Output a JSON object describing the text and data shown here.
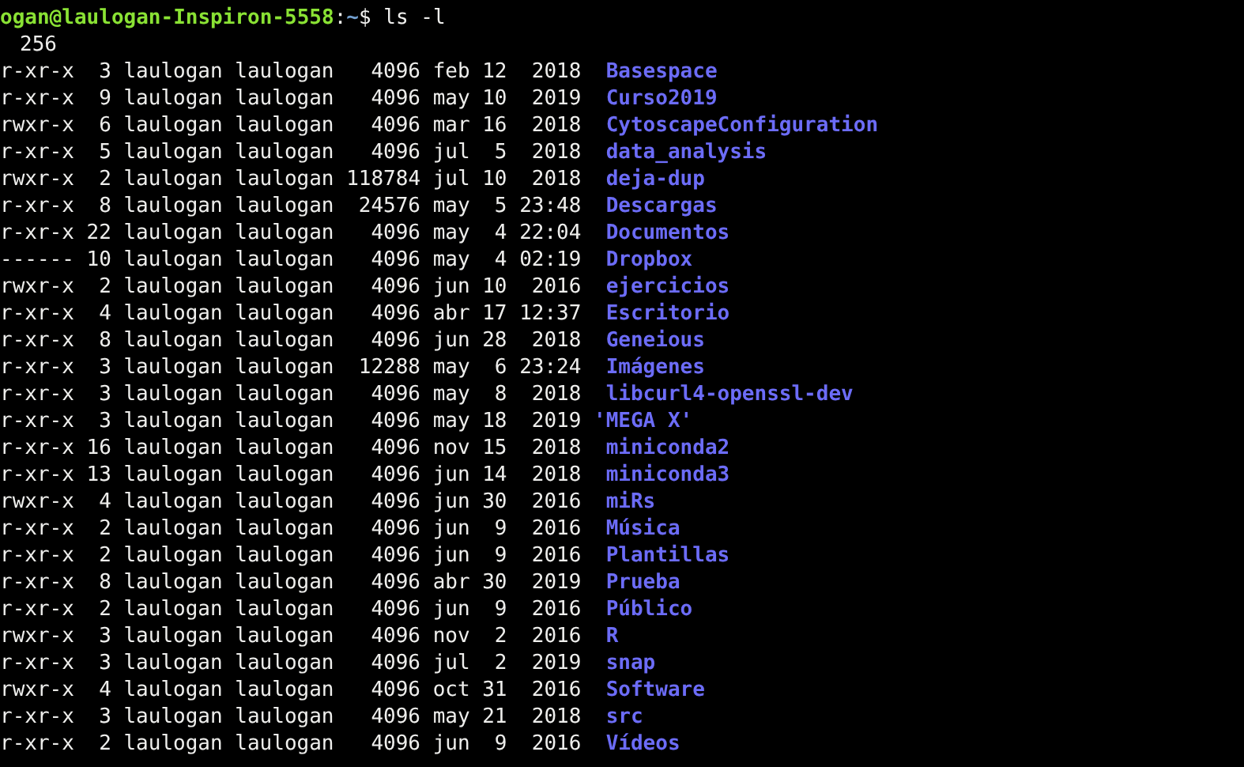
{
  "prompt": {
    "user_host": "ogan@laulogan-Inspiron-5558",
    "separator": ":",
    "path": "~",
    "symbol": "$",
    "command": "ls -l"
  },
  "total": {
    "value": "256"
  },
  "entries": [
    {
      "perms": "r-xr-x",
      "links": "3",
      "owner": "laulogan",
      "group": "laulogan",
      "size": "4096",
      "month": "feb",
      "day": "12",
      "time": "2018",
      "name": "Basespace",
      "kind": "dir",
      "quoted": false
    },
    {
      "perms": "r-xr-x",
      "links": "9",
      "owner": "laulogan",
      "group": "laulogan",
      "size": "4096",
      "month": "may",
      "day": "10",
      "time": "2019",
      "name": "Curso2019",
      "kind": "dir",
      "quoted": false
    },
    {
      "perms": "rwxr-x",
      "links": "6",
      "owner": "laulogan",
      "group": "laulogan",
      "size": "4096",
      "month": "mar",
      "day": "16",
      "time": "2018",
      "name": "CytoscapeConfiguration",
      "kind": "dir",
      "quoted": false
    },
    {
      "perms": "r-xr-x",
      "links": "5",
      "owner": "laulogan",
      "group": "laulogan",
      "size": "4096",
      "month": "jul",
      "day": "5",
      "time": "2018",
      "name": "data_analysis",
      "kind": "dir",
      "quoted": false
    },
    {
      "perms": "rwxr-x",
      "links": "2",
      "owner": "laulogan",
      "group": "laulogan",
      "size": "118784",
      "month": "jul",
      "day": "10",
      "time": "2018",
      "name": "deja-dup",
      "kind": "dir",
      "quoted": false
    },
    {
      "perms": "r-xr-x",
      "links": "8",
      "owner": "laulogan",
      "group": "laulogan",
      "size": "24576",
      "month": "may",
      "day": "5",
      "time": "23:48",
      "name": "Descargas",
      "kind": "dir",
      "quoted": false
    },
    {
      "perms": "r-xr-x",
      "links": "22",
      "owner": "laulogan",
      "group": "laulogan",
      "size": "4096",
      "month": "may",
      "day": "4",
      "time": "22:04",
      "name": "Documentos",
      "kind": "dir",
      "quoted": false
    },
    {
      "perms": "------",
      "links": "10",
      "owner": "laulogan",
      "group": "laulogan",
      "size": "4096",
      "month": "may",
      "day": "4",
      "time": "02:19",
      "name": "Dropbox",
      "kind": "dir",
      "quoted": false
    },
    {
      "perms": "rwxr-x",
      "links": "2",
      "owner": "laulogan",
      "group": "laulogan",
      "size": "4096",
      "month": "jun",
      "day": "10",
      "time": "2016",
      "name": "ejercicios",
      "kind": "dir",
      "quoted": false
    },
    {
      "perms": "r-xr-x",
      "links": "4",
      "owner": "laulogan",
      "group": "laulogan",
      "size": "4096",
      "month": "abr",
      "day": "17",
      "time": "12:37",
      "name": "Escritorio",
      "kind": "dir",
      "quoted": false
    },
    {
      "perms": "r-xr-x",
      "links": "8",
      "owner": "laulogan",
      "group": "laulogan",
      "size": "4096",
      "month": "jun",
      "day": "28",
      "time": "2018",
      "name": "Geneious",
      "kind": "dir",
      "quoted": false
    },
    {
      "perms": "r-xr-x",
      "links": "3",
      "owner": "laulogan",
      "group": "laulogan",
      "size": "12288",
      "month": "may",
      "day": "6",
      "time": "23:24",
      "name": "Imágenes",
      "kind": "dir",
      "quoted": false
    },
    {
      "perms": "r-xr-x",
      "links": "3",
      "owner": "laulogan",
      "group": "laulogan",
      "size": "4096",
      "month": "may",
      "day": "8",
      "time": "2018",
      "name": "libcurl4-openssl-dev",
      "kind": "dir",
      "quoted": false
    },
    {
      "perms": "r-xr-x",
      "links": "3",
      "owner": "laulogan",
      "group": "laulogan",
      "size": "4096",
      "month": "may",
      "day": "18",
      "time": "2019",
      "name": "'MEGA X'",
      "kind": "dir",
      "quoted": true
    },
    {
      "perms": "r-xr-x",
      "links": "16",
      "owner": "laulogan",
      "group": "laulogan",
      "size": "4096",
      "month": "nov",
      "day": "15",
      "time": "2018",
      "name": "miniconda2",
      "kind": "dir",
      "quoted": false
    },
    {
      "perms": "r-xr-x",
      "links": "13",
      "owner": "laulogan",
      "group": "laulogan",
      "size": "4096",
      "month": "jun",
      "day": "14",
      "time": "2018",
      "name": "miniconda3",
      "kind": "dir",
      "quoted": false
    },
    {
      "perms": "rwxr-x",
      "links": "4",
      "owner": "laulogan",
      "group": "laulogan",
      "size": "4096",
      "month": "jun",
      "day": "30",
      "time": "2016",
      "name": "miRs",
      "kind": "dir",
      "quoted": false
    },
    {
      "perms": "r-xr-x",
      "links": "2",
      "owner": "laulogan",
      "group": "laulogan",
      "size": "4096",
      "month": "jun",
      "day": "9",
      "time": "2016",
      "name": "Música",
      "kind": "dir",
      "quoted": false
    },
    {
      "perms": "r-xr-x",
      "links": "2",
      "owner": "laulogan",
      "group": "laulogan",
      "size": "4096",
      "month": "jun",
      "day": "9",
      "time": "2016",
      "name": "Plantillas",
      "kind": "dir",
      "quoted": false
    },
    {
      "perms": "r-xr-x",
      "links": "8",
      "owner": "laulogan",
      "group": "laulogan",
      "size": "4096",
      "month": "abr",
      "day": "30",
      "time": "2019",
      "name": "Prueba",
      "kind": "dir",
      "quoted": false
    },
    {
      "perms": "r-xr-x",
      "links": "2",
      "owner": "laulogan",
      "group": "laulogan",
      "size": "4096",
      "month": "jun",
      "day": "9",
      "time": "2016",
      "name": "Público",
      "kind": "dir",
      "quoted": false
    },
    {
      "perms": "rwxr-x",
      "links": "3",
      "owner": "laulogan",
      "group": "laulogan",
      "size": "4096",
      "month": "nov",
      "day": "2",
      "time": "2016",
      "name": "R",
      "kind": "dir",
      "quoted": false
    },
    {
      "perms": "r-xr-x",
      "links": "3",
      "owner": "laulogan",
      "group": "laulogan",
      "size": "4096",
      "month": "jul",
      "day": "2",
      "time": "2019",
      "name": "snap",
      "kind": "dir",
      "quoted": false
    },
    {
      "perms": "rwxr-x",
      "links": "4",
      "owner": "laulogan",
      "group": "laulogan",
      "size": "4096",
      "month": "oct",
      "day": "31",
      "time": "2016",
      "name": "Software",
      "kind": "dir",
      "quoted": false
    },
    {
      "perms": "r-xr-x",
      "links": "3",
      "owner": "laulogan",
      "group": "laulogan",
      "size": "4096",
      "month": "may",
      "day": "21",
      "time": "2018",
      "name": "src",
      "kind": "dir",
      "quoted": false
    },
    {
      "perms": "r-xr-x",
      "links": "2",
      "owner": "laulogan",
      "group": "laulogan",
      "size": "4096",
      "month": "jun",
      "day": "9",
      "time": "2016",
      "name": "Vídeos",
      "kind": "dir",
      "quoted": false
    }
  ]
}
